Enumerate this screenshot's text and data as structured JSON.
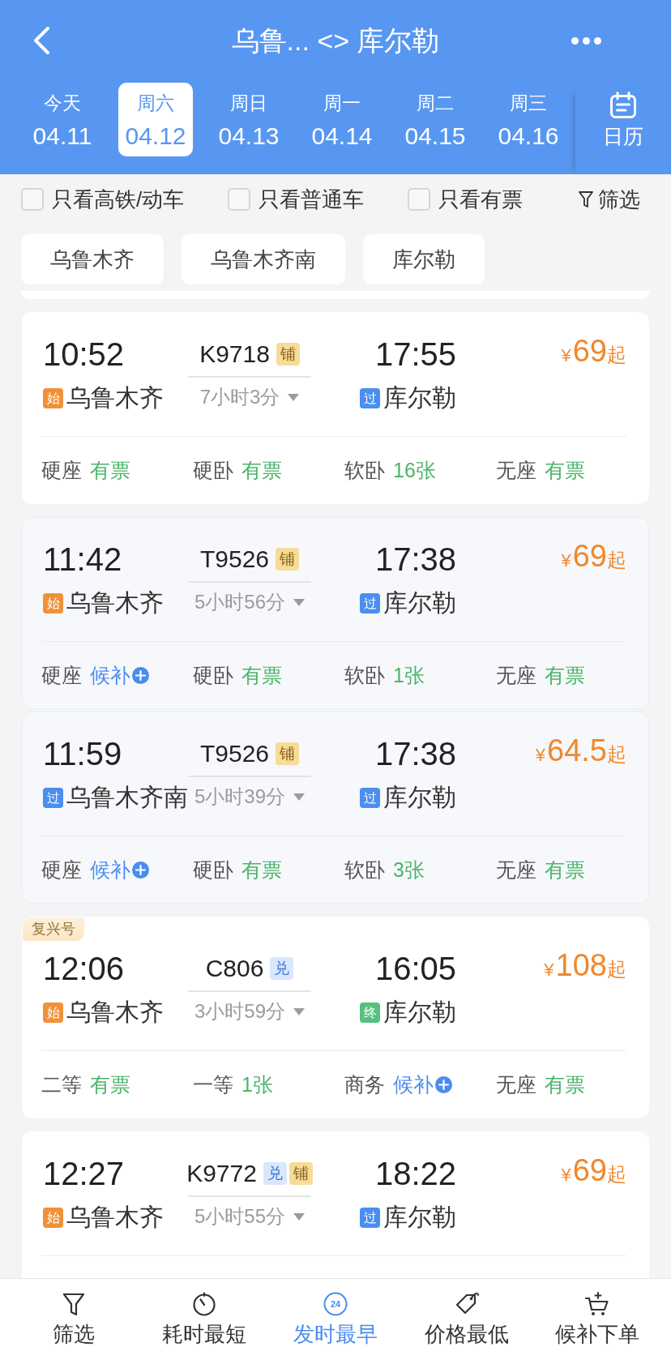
{
  "header": {
    "title": "乌鲁... <> 库尔勒"
  },
  "dates": [
    {
      "day": "今天",
      "date": "04.11",
      "selected": false
    },
    {
      "day": "周六",
      "date": "04.12",
      "selected": true
    },
    {
      "day": "周日",
      "date": "04.13",
      "selected": false
    },
    {
      "day": "周一",
      "date": "04.14",
      "selected": false
    },
    {
      "day": "周二",
      "date": "04.15",
      "selected": false
    },
    {
      "day": "周三",
      "date": "04.16",
      "selected": false
    }
  ],
  "calendar": {
    "label": "日历"
  },
  "filters": [
    {
      "label": "只看高铁/动车",
      "checked": false
    },
    {
      "label": "只看普通车",
      "checked": false
    },
    {
      "label": "只看有票",
      "checked": false
    }
  ],
  "filter_button": {
    "label": "筛选"
  },
  "stations": [
    {
      "label": "乌鲁木齐",
      "selected": false
    },
    {
      "label": "乌鲁木齐南",
      "selected": false
    },
    {
      "label": "库尔勒",
      "selected": false
    }
  ],
  "trains": [
    {
      "highlighted": false,
      "depart_time": "10:52",
      "depart_station": {
        "badge": "始",
        "kind": "origin",
        "name": "乌鲁木齐"
      },
      "number": "K9718",
      "tags": [
        {
          "text": "铺",
          "kind": "berth"
        }
      ],
      "duration": "7小时3分",
      "arrive_time": "17:55",
      "arrive_station": {
        "badge": "过",
        "kind": "pass",
        "name": "库尔勒"
      },
      "price": {
        "currency": "¥",
        "amount": "69",
        "suffix": "起"
      },
      "seats": [
        {
          "name": "硬座",
          "status": "有票",
          "kind": "available"
        },
        {
          "name": "硬卧",
          "status": "有票",
          "kind": "available"
        },
        {
          "name": "软卧",
          "status": "16张",
          "kind": "available"
        },
        {
          "name": "无座",
          "status": "有票",
          "kind": "available"
        }
      ]
    },
    {
      "highlighted": true,
      "depart_time": "11:42",
      "depart_station": {
        "badge": "始",
        "kind": "origin",
        "name": "乌鲁木齐"
      },
      "number": "T9526",
      "tags": [
        {
          "text": "铺",
          "kind": "berth"
        }
      ],
      "duration": "5小时56分",
      "arrive_time": "17:38",
      "arrive_station": {
        "badge": "过",
        "kind": "pass",
        "name": "库尔勒"
      },
      "price": {
        "currency": "¥",
        "amount": "69",
        "suffix": "起"
      },
      "seats": [
        {
          "name": "硬座",
          "status": "候补",
          "kind": "waitlist"
        },
        {
          "name": "硬卧",
          "status": "有票",
          "kind": "available"
        },
        {
          "name": "软卧",
          "status": "1张",
          "kind": "available"
        },
        {
          "name": "无座",
          "status": "有票",
          "kind": "available"
        }
      ]
    },
    {
      "highlighted": true,
      "depart_time": "11:59",
      "depart_station": {
        "badge": "过",
        "kind": "pass",
        "name": "乌鲁木齐南"
      },
      "number": "T9526",
      "tags": [
        {
          "text": "铺",
          "kind": "berth"
        }
      ],
      "duration": "5小时39分",
      "arrive_time": "17:38",
      "arrive_station": {
        "badge": "过",
        "kind": "pass",
        "name": "库尔勒"
      },
      "price": {
        "currency": "¥",
        "amount": "64.5",
        "suffix": "起"
      },
      "seats": [
        {
          "name": "硬座",
          "status": "候补",
          "kind": "waitlist"
        },
        {
          "name": "硬卧",
          "status": "有票",
          "kind": "available"
        },
        {
          "name": "软卧",
          "status": "3张",
          "kind": "available"
        },
        {
          "name": "无座",
          "status": "有票",
          "kind": "available"
        }
      ]
    },
    {
      "highlighted": false,
      "label_tag": "复兴号",
      "depart_time": "12:06",
      "depart_station": {
        "badge": "始",
        "kind": "origin",
        "name": "乌鲁木齐"
      },
      "number": "C806",
      "tags": [
        {
          "text": "兑",
          "kind": "exchange"
        }
      ],
      "duration": "3小时59分",
      "arrive_time": "16:05",
      "arrive_station": {
        "badge": "终",
        "kind": "terminal",
        "name": "库尔勒"
      },
      "price": {
        "currency": "¥",
        "amount": "108",
        "suffix": "起"
      },
      "seats": [
        {
          "name": "二等",
          "status": "有票",
          "kind": "available"
        },
        {
          "name": "一等",
          "status": "1张",
          "kind": "available"
        },
        {
          "name": "商务",
          "status": "候补",
          "kind": "waitlist"
        },
        {
          "name": "无座",
          "status": "有票",
          "kind": "available"
        }
      ]
    },
    {
      "highlighted": false,
      "depart_time": "12:27",
      "depart_station": {
        "badge": "始",
        "kind": "origin",
        "name": "乌鲁木齐"
      },
      "number": "K9772",
      "tags": [
        {
          "text": "兑",
          "kind": "exchange"
        },
        {
          "text": "铺",
          "kind": "berth"
        }
      ],
      "duration": "5小时55分",
      "arrive_time": "18:22",
      "arrive_station": {
        "badge": "过",
        "kind": "pass",
        "name": "库尔勒"
      },
      "price": {
        "currency": "¥",
        "amount": "69",
        "suffix": "起"
      }
    }
  ],
  "bottom_bar": [
    {
      "label": "筛选",
      "kind": "funnel",
      "selected": false
    },
    {
      "label": "耗时最短",
      "kind": "timer",
      "selected": false
    },
    {
      "label": "发时最早",
      "kind": "clock",
      "icon_text": "24",
      "selected": true
    },
    {
      "label": "价格最低",
      "kind": "tag",
      "selected": false
    },
    {
      "label": "候补下单",
      "kind": "cart",
      "selected": false
    }
  ]
}
